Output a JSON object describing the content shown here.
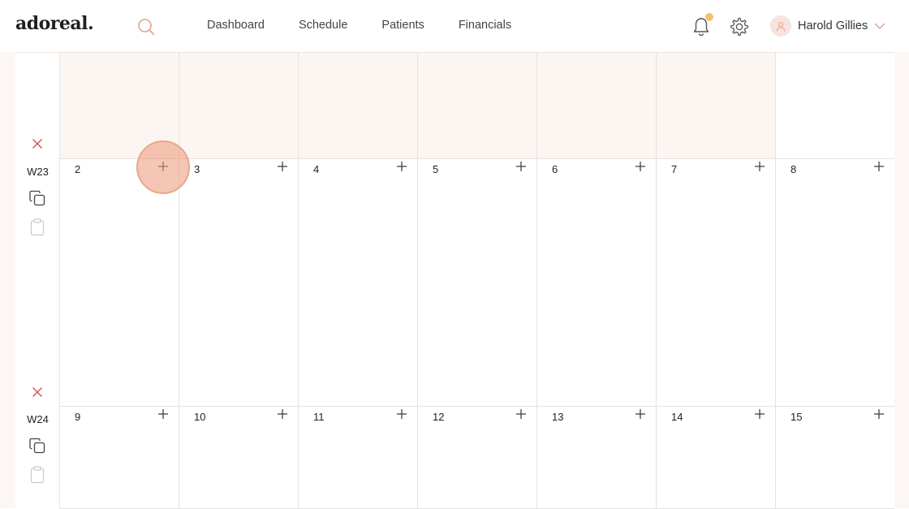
{
  "brand": "adoreal.",
  "header": {
    "nav": [
      "Dashboard",
      "Schedule",
      "Patients",
      "Financials"
    ],
    "user_name": "Harold Gillies",
    "notification_badge_color": "#f3c170",
    "accent": "#e9a88e"
  },
  "calendar": {
    "weeks": [
      {
        "label": "",
        "days": [
          "",
          "",
          "",
          "",
          "",
          "",
          ""
        ],
        "shaded": [
          true,
          true,
          true,
          true,
          true,
          true,
          false
        ]
      },
      {
        "label": "W23",
        "days": [
          "2",
          "3",
          "4",
          "5",
          "6",
          "7",
          "8"
        ]
      },
      {
        "label": "W24",
        "days": [
          "9",
          "10",
          "11",
          "12",
          "13",
          "14",
          "15"
        ]
      }
    ],
    "icons": {
      "remove": "close-icon",
      "copy": "copy-icon",
      "paste": "clipboard-icon",
      "add": "plus-icon"
    }
  }
}
